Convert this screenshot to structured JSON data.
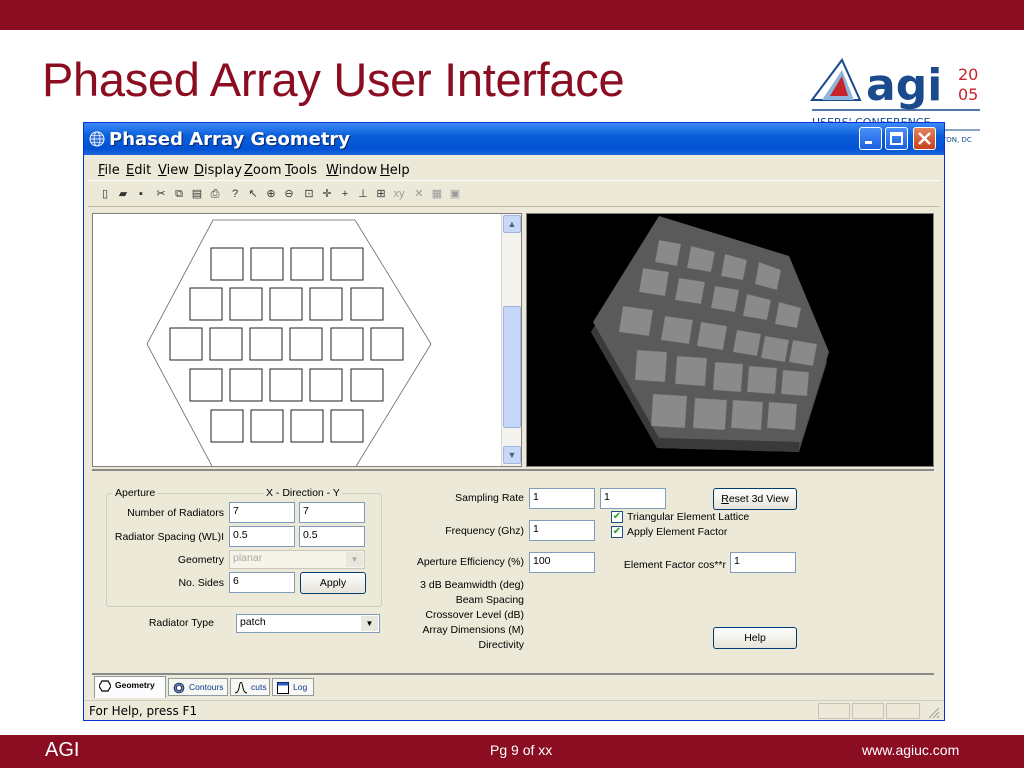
{
  "slide": {
    "title": "Phased Array User Interface",
    "footer_left": "AGI",
    "footer_center": "Pg 9 of xx",
    "footer_right": "www.agiuc.com",
    "brand_color": "#8b0d22"
  },
  "logo": {
    "text": "agi",
    "year_top": "20",
    "year_bottom": "05",
    "sub1": "USERS' CONFERENCE",
    "sub2": "TON, DC"
  },
  "window": {
    "title": "Phased Array Geometry",
    "minimize_icon": "minimize-icon",
    "maximize_icon": "maximize-icon",
    "close_icon": "close-icon"
  },
  "menu": {
    "items": [
      {
        "ul": "F",
        "rest": "ile"
      },
      {
        "ul": "E",
        "rest": "dit"
      },
      {
        "ul": "V",
        "rest": "iew"
      },
      {
        "ul": "D",
        "rest": "isplay"
      },
      {
        "ul": "Z",
        "rest": "oom"
      },
      {
        "ul": "T",
        "rest": "ools"
      },
      {
        "ul": "W",
        "rest": "indow"
      },
      {
        "ul": "H",
        "rest": "elp"
      }
    ]
  },
  "toolbar": {
    "icons": [
      "new-icon",
      "open-icon",
      "save-icon",
      "cut-icon",
      "copy-icon",
      "paste-icon",
      "print-icon",
      "help-icon",
      "context-help-icon",
      "zoom-in-icon",
      "zoom-out-icon",
      "zoom-fit-icon",
      "crosshair-icon",
      "plus-icon",
      "axis-icon",
      "grid-icon",
      "xy-icon",
      "delete-icon",
      "properties-icon",
      "document-icon"
    ],
    "xy_label": "xy"
  },
  "panel": {
    "aperture_label": "Aperture",
    "direction_label": "X - Direction - Y",
    "num_radiators_label": "Number of Radiators",
    "num_radiators_x": "7",
    "num_radiators_y": "7",
    "spacing_label": "Radiator Spacing (WL)I",
    "spacing_x": "0.5",
    "spacing_y": "0.5",
    "geometry_label": "Geometry",
    "geometry_value": "planar",
    "sides_label": "No. Sides",
    "sides_value": "6",
    "apply_label": "Apply",
    "radiator_type_label": "Radiator Type",
    "radiator_type_value": "patch",
    "sampling_rate_label": "Sampling Rate",
    "sampling_rate_1": "1",
    "sampling_rate_2": "1",
    "reset_label": "Reset 3d View",
    "reset_ul": "R",
    "reset_rest": "eset 3d View",
    "frequency_label": "Frequency (Ghz)",
    "frequency_value": "1",
    "triangular_label": "Triangular Element Lattice",
    "triangular_checked": true,
    "apply_factor_label": "Apply Element Factor",
    "apply_factor_checked": true,
    "aperture_eff_label": "Aperture Efficiency (%)",
    "aperture_eff_value": "100",
    "element_factor_label": "Element Factor cos**r",
    "element_factor_value": "1",
    "beamwidth_label": "3 dB Beamwidth (deg)",
    "beam_spacing_label": "Beam Spacing",
    "crossover_label": "Crossover Level (dB)",
    "array_dims_label": "Array Dimensions (M)",
    "directivity_label": "Directivity",
    "help_label": "Help"
  },
  "tabs": [
    {
      "label": "Geometry",
      "icon": "geometry-icon",
      "active": true
    },
    {
      "label": "Contours",
      "icon": "contours-icon",
      "active": false
    },
    {
      "label": "cuts",
      "icon": "cuts-icon",
      "active": false
    },
    {
      "label": "Log",
      "icon": "log-icon",
      "active": false
    }
  ],
  "status": {
    "text": "For Help, press F1"
  }
}
